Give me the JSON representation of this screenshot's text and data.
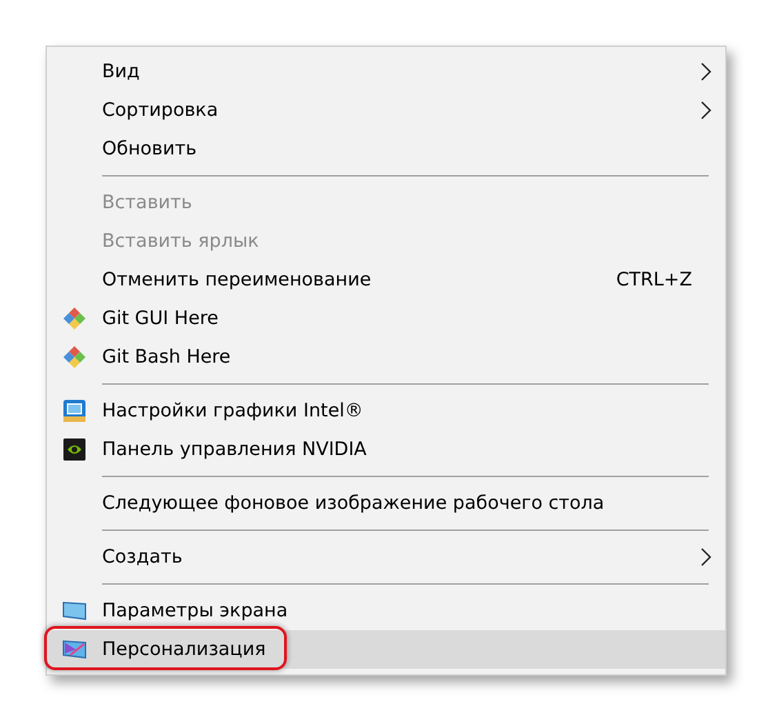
{
  "menu": {
    "sections": [
      {
        "items": [
          {
            "label": "Вид",
            "kind": "plain",
            "submenu": true,
            "disabled": false,
            "selected": false,
            "outlined": false
          },
          {
            "label": "Сортировка",
            "kind": "plain",
            "submenu": true,
            "disabled": false,
            "selected": false,
            "outlined": false
          },
          {
            "label": "Обновить",
            "kind": "plain",
            "submenu": false,
            "disabled": false,
            "selected": false,
            "outlined": false
          }
        ]
      },
      {
        "items": [
          {
            "label": "Вставить",
            "kind": "plain",
            "submenu": false,
            "disabled": true,
            "selected": false,
            "outlined": false
          },
          {
            "label": "Вставить ярлык",
            "kind": "plain",
            "submenu": false,
            "disabled": true,
            "selected": false,
            "outlined": false
          },
          {
            "label": "Отменить переименование",
            "shortcut": "CTRL+Z",
            "kind": "plain",
            "submenu": false,
            "disabled": false,
            "selected": false,
            "outlined": false
          },
          {
            "label": "Git GUI Here",
            "kind": "git",
            "submenu": false,
            "disabled": false,
            "selected": false,
            "outlined": false
          },
          {
            "label": "Git Bash Here",
            "kind": "git",
            "submenu": false,
            "disabled": false,
            "selected": false,
            "outlined": false
          }
        ]
      },
      {
        "items": [
          {
            "label": "Настройки графики Intel®",
            "kind": "intel",
            "submenu": false,
            "disabled": false,
            "selected": false,
            "outlined": false
          },
          {
            "label": "Панель управления NVIDIA",
            "kind": "nvidia",
            "submenu": false,
            "disabled": false,
            "selected": false,
            "outlined": false
          }
        ]
      },
      {
        "items": [
          {
            "label": "Следующее фоновое изображение рабочего стола",
            "kind": "plain",
            "submenu": false,
            "disabled": false,
            "selected": false,
            "outlined": false
          }
        ]
      },
      {
        "items": [
          {
            "label": "Создать",
            "kind": "plain",
            "submenu": true,
            "disabled": false,
            "selected": false,
            "outlined": false
          }
        ]
      },
      {
        "items": [
          {
            "label": "Параметры экрана",
            "kind": "display",
            "submenu": false,
            "disabled": false,
            "selected": false,
            "outlined": false
          },
          {
            "label": "Персонализация",
            "kind": "personalize",
            "submenu": false,
            "disabled": false,
            "selected": true,
            "outlined": true
          }
        ]
      }
    ]
  }
}
